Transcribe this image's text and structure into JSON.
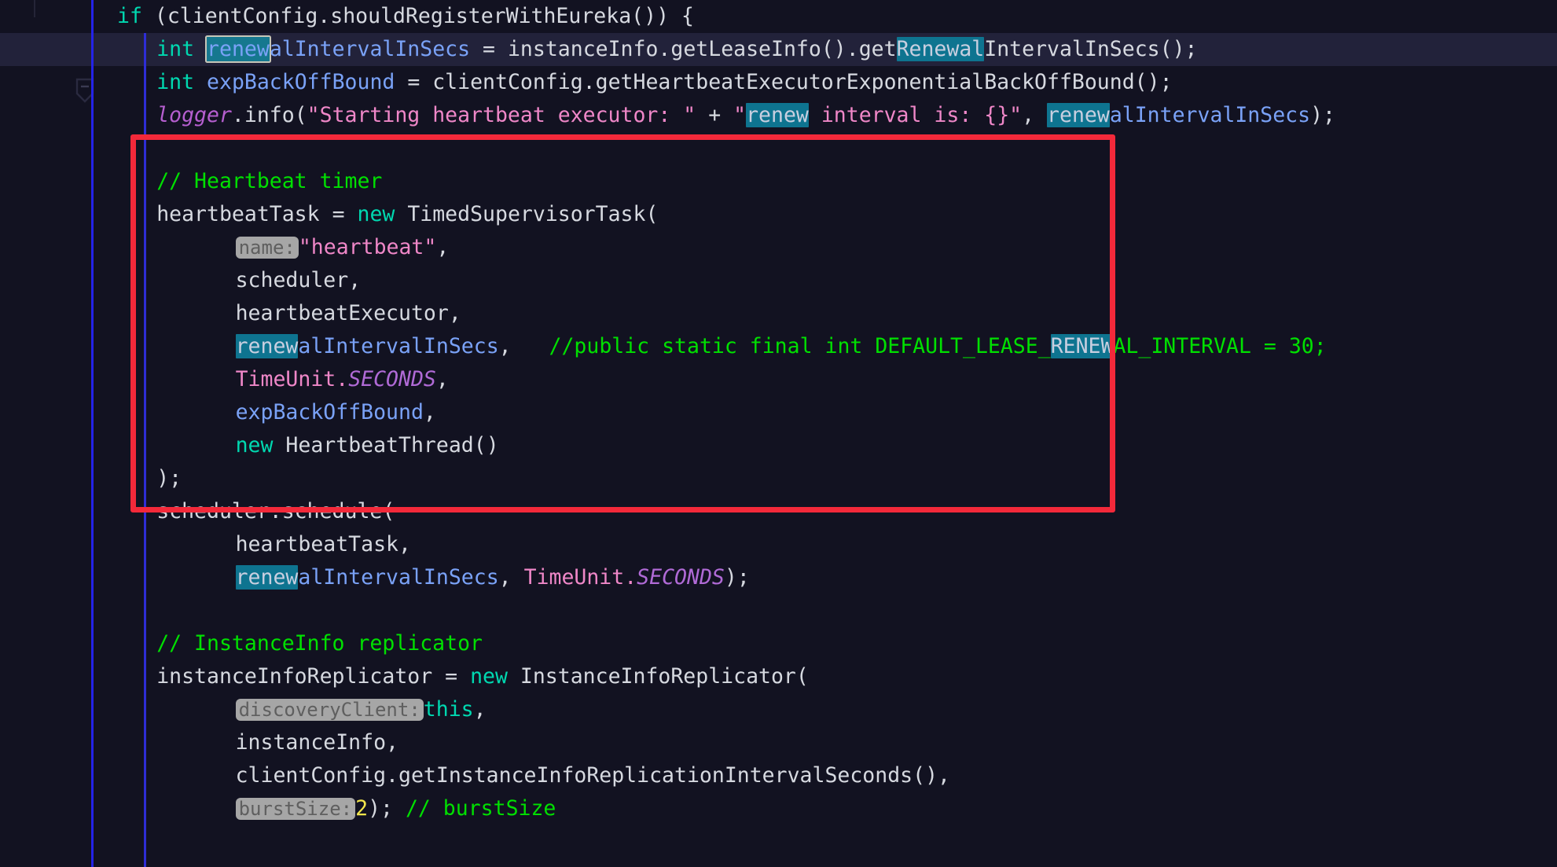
{
  "app": {
    "kind": "code-editor",
    "theme": "dark",
    "language": "java",
    "font_size_px": 26.5
  },
  "colors": {
    "background": "#121221",
    "caret_line": "#22223a",
    "search_highlight": "#0e7490",
    "search_current_border": "#c6c6b8",
    "annotation_box": "#f3293a",
    "comment": "#00e000",
    "keyword": "#00d8b0",
    "variable": "#7aa2f7",
    "string": "#ef87c8",
    "number": "#f2e54c",
    "constant_italic": "#b06ad6",
    "hint_badge_bg": "#a6a6a6",
    "hint_badge_fg": "#5f5f5f",
    "indent_guide": "#2423e8"
  },
  "gutter": {
    "fold_marker_icon": "fold-collapse-icon",
    "fold_marker_glyph": "−"
  },
  "search": {
    "term": "renew",
    "current_match_line": 2
  },
  "annotation": {
    "shape": "rectangle",
    "label": "heartbeat-timer-block-highlight",
    "covers_lines": [
      5,
      13
    ]
  },
  "code": {
    "lines": [
      {
        "n": 1,
        "indent": 0,
        "tokens": [
          {
            "t": "if",
            "c": "kw"
          },
          {
            "t": " ",
            "c": "plain"
          },
          {
            "t": "(clientConfig.shouldRegisterWithEureka()) {",
            "c": "plain"
          }
        ]
      },
      {
        "n": 2,
        "indent": 1,
        "caret": true,
        "tokens": [
          {
            "t": "int",
            "c": "kw"
          },
          {
            "t": " ",
            "c": "plain"
          },
          {
            "t": "renew",
            "c": "var",
            "hl": "current"
          },
          {
            "t": "alIntervalInSecs",
            "c": "var"
          },
          {
            "t": " = ",
            "c": "plain"
          },
          {
            "t": "instanceInfo.getLeaseInfo().get",
            "c": "plain"
          },
          {
            "t": "Renewal",
            "c": "plain",
            "hl": "match"
          },
          {
            "t": "IntervalInSecs();",
            "c": "plain"
          }
        ]
      },
      {
        "n": 3,
        "indent": 1,
        "tokens": [
          {
            "t": "int",
            "c": "kw"
          },
          {
            "t": " ",
            "c": "plain"
          },
          {
            "t": "expBackOffBound",
            "c": "var"
          },
          {
            "t": " = clientConfig.getHeartbeatExecutorExponentialBackOffBound();",
            "c": "plain"
          }
        ]
      },
      {
        "n": 4,
        "indent": 1,
        "tokens": [
          {
            "t": "logger",
            "c": "logger"
          },
          {
            "t": ".info(",
            "c": "plain"
          },
          {
            "t": "\"Starting heartbeat executor: \"",
            "c": "str"
          },
          {
            "t": " + ",
            "c": "plain"
          },
          {
            "t": "\"",
            "c": "str"
          },
          {
            "t": "renew",
            "c": "str",
            "hl": "match"
          },
          {
            "t": " interval is: {}\"",
            "c": "str"
          },
          {
            "t": ", ",
            "c": "plain"
          },
          {
            "t": "renew",
            "c": "var",
            "hl": "match"
          },
          {
            "t": "alIntervalInSecs",
            "c": "var"
          },
          {
            "t": ");",
            "c": "plain"
          }
        ]
      },
      {
        "n": 5,
        "indent": 0,
        "blank": true,
        "tokens": []
      },
      {
        "n": 6,
        "indent": 1,
        "tokens": [
          {
            "t": "// Heartbeat timer",
            "c": "cmt"
          }
        ]
      },
      {
        "n": 7,
        "indent": 1,
        "tokens": [
          {
            "t": "heartbeatTask",
            "c": "plain"
          },
          {
            "t": " = ",
            "c": "plain"
          },
          {
            "t": "new",
            "c": "kw"
          },
          {
            "t": " TimedSupervisorTask(",
            "c": "plain"
          }
        ]
      },
      {
        "n": 8,
        "indent": 3,
        "tokens": [
          {
            "t": "name:",
            "c": "hint",
            "hint": true
          },
          {
            "t": "\"heartbeat\"",
            "c": "str"
          },
          {
            "t": ",",
            "c": "plain"
          }
        ]
      },
      {
        "n": 9,
        "indent": 3,
        "tokens": [
          {
            "t": "scheduler",
            "c": "plain"
          },
          {
            "t": ",",
            "c": "plain"
          }
        ]
      },
      {
        "n": 10,
        "indent": 3,
        "tokens": [
          {
            "t": "heartbeatExecutor",
            "c": "plain"
          },
          {
            "t": ",",
            "c": "plain"
          }
        ]
      },
      {
        "n": 11,
        "indent": 3,
        "tokens": [
          {
            "t": "renew",
            "c": "var",
            "hl": "match"
          },
          {
            "t": "alIntervalInSecs",
            "c": "var"
          },
          {
            "t": ",",
            "c": "plain"
          },
          {
            "t": "   ",
            "c": "plain"
          },
          {
            "t": "//public static final int DEFAULT_LEASE_",
            "c": "cmt"
          },
          {
            "t": "RENEW",
            "c": "cmt",
            "hl": "match"
          },
          {
            "t": "AL_INTERVAL = 30;",
            "c": "cmt"
          }
        ]
      },
      {
        "n": 12,
        "indent": 3,
        "tokens": [
          {
            "t": "TimeUnit.",
            "c": "str"
          },
          {
            "t": "SECONDS",
            "c": "const"
          },
          {
            "t": ",",
            "c": "plain"
          }
        ]
      },
      {
        "n": 13,
        "indent": 3,
        "tokens": [
          {
            "t": "expBackOffBound",
            "c": "var"
          },
          {
            "t": ",",
            "c": "plain"
          }
        ]
      },
      {
        "n": 14,
        "indent": 3,
        "tokens": [
          {
            "t": "new",
            "c": "kw"
          },
          {
            "t": " HeartbeatThread()",
            "c": "plain"
          }
        ]
      },
      {
        "n": 15,
        "indent": 1,
        "tokens": [
          {
            "t": ");",
            "c": "plain"
          }
        ]
      },
      {
        "n": 16,
        "indent": 1,
        "tokens": [
          {
            "t": "scheduler.schedule(",
            "c": "plain"
          }
        ]
      },
      {
        "n": 17,
        "indent": 3,
        "tokens": [
          {
            "t": "heartbeatTask",
            "c": "plain"
          },
          {
            "t": ",",
            "c": "plain"
          }
        ]
      },
      {
        "n": 18,
        "indent": 3,
        "tokens": [
          {
            "t": "renew",
            "c": "var",
            "hl": "match"
          },
          {
            "t": "alIntervalInSecs",
            "c": "var"
          },
          {
            "t": ", ",
            "c": "plain"
          },
          {
            "t": "TimeUnit.",
            "c": "str"
          },
          {
            "t": "SECONDS",
            "c": "const"
          },
          {
            "t": ");",
            "c": "plain"
          }
        ]
      },
      {
        "n": 19,
        "indent": 0,
        "blank": true,
        "tokens": []
      },
      {
        "n": 20,
        "indent": 1,
        "tokens": [
          {
            "t": "// InstanceInfo replicator",
            "c": "cmt"
          }
        ]
      },
      {
        "n": 21,
        "indent": 1,
        "tokens": [
          {
            "t": "instanceInfoReplicator",
            "c": "plain"
          },
          {
            "t": " = ",
            "c": "plain"
          },
          {
            "t": "new",
            "c": "kw"
          },
          {
            "t": " InstanceInfoReplicator(",
            "c": "plain"
          }
        ]
      },
      {
        "n": 22,
        "indent": 3,
        "tokens": [
          {
            "t": "discoveryClient:",
            "c": "hint",
            "hint": true
          },
          {
            "t": "this",
            "c": "kw"
          },
          {
            "t": ",",
            "c": "plain"
          }
        ]
      },
      {
        "n": 23,
        "indent": 3,
        "tokens": [
          {
            "t": "instanceInfo",
            "c": "plain"
          },
          {
            "t": ",",
            "c": "plain"
          }
        ]
      },
      {
        "n": 24,
        "indent": 3,
        "tokens": [
          {
            "t": "clientConfig.getInstanceInfoReplicationIntervalSeconds()",
            "c": "plain"
          },
          {
            "t": ",",
            "c": "plain"
          }
        ]
      },
      {
        "n": 25,
        "indent": 3,
        "tokens": [
          {
            "t": "burstSize:",
            "c": "hint",
            "hint": true
          },
          {
            "t": "2",
            "c": "num"
          },
          {
            "t": "); ",
            "c": "plain"
          },
          {
            "t": "// burstSize",
            "c": "cmt"
          }
        ]
      }
    ]
  }
}
